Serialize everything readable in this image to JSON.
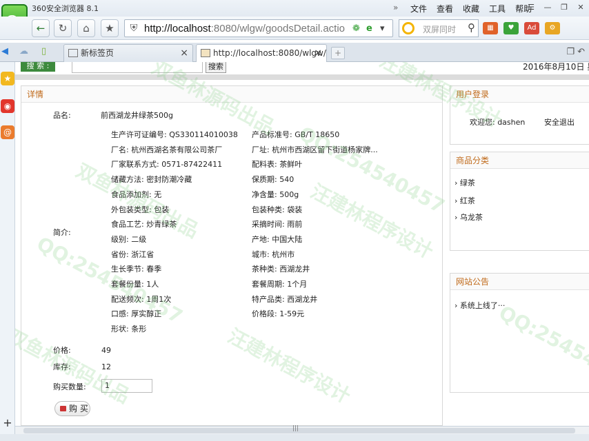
{
  "browser": {
    "app_title": "360安全浏览器 8.1",
    "menu": [
      "文件",
      "查看",
      "收藏",
      "工具",
      "帮助"
    ],
    "url_host": "http://localhost",
    "url_rest": ":8080/wlgw/goodsDetail.actio",
    "search_placeholder": "双屏同时",
    "tabs": [
      {
        "label": "新标签页"
      },
      {
        "label": "http://localhost:8080/wlgw/g"
      }
    ]
  },
  "page": {
    "search_button": "搜 索 :",
    "search_go": "搜索",
    "date": "2016年8月10日 星",
    "detail_title": "详情",
    "labels": {
      "name": "品名:",
      "intro": "简介:",
      "price": "价格:",
      "stock": "库存:",
      "qty": "购买数量:"
    },
    "product_name": "前西湖龙井绿茶500g",
    "specs_left": [
      "生产许可证编号: QS330114010038",
      "厂名: 杭州西湖名茶有限公司茶厂",
      "厂家联系方式: 0571-87422411",
      "储藏方法: 密封防潮冷藏",
      "食品添加剂: 无",
      "外包装类型: 包装",
      "食品工艺: 炒青绿茶",
      "级别: 二级",
      "省份: 浙江省",
      "生长季节: 春季",
      "套餐份量: 1人",
      "配送频次: 1周1次",
      "口感: 厚实醇正",
      "形状: 条形"
    ],
    "specs_right": [
      "产品标准号: GB/T 18650",
      "厂址: 杭州市西湖区留下街道杨家牌...",
      "配料表: 茶鲜叶",
      "保质期: 540",
      "净含量: 500g",
      "包装种类: 袋装",
      "采摘时间: 雨前",
      "产地: 中国大陆",
      "城市: 杭州市",
      "茶种类: 西湖龙井",
      "套餐周期: 1个月",
      "特产品类: 西湖龙井",
      "价格段: 1-59元"
    ],
    "price": "49",
    "stock": "12",
    "qty_value": "1",
    "buy_button": "购 买",
    "login_title": "用户登录",
    "welcome": "欢迎您: dashen",
    "logout": "安全退出",
    "category_title": "商品分类",
    "categories": [
      "绿茶",
      "红茶",
      "乌龙茶"
    ],
    "notice_title": "网站公告",
    "notices": [
      "系统上线了···"
    ]
  },
  "watermark": {
    "qq": "QQ:254540457",
    "source": "双鱼林源码出品",
    "program": "汪建林程序设计"
  }
}
